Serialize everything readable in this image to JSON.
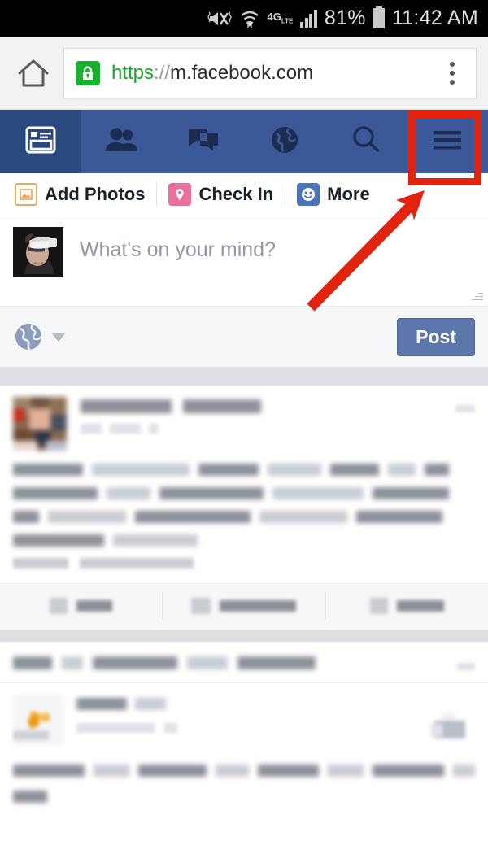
{
  "status_bar": {
    "icons": [
      "mute-vibrate-icon",
      "wifi-icon",
      "signal-bars-icon"
    ],
    "network_label": "4G",
    "network_sub": "LTE",
    "battery_percent": "81%",
    "time": "11:42 AM"
  },
  "browser": {
    "home_icon": "home-icon",
    "lock_icon": "lock-icon",
    "url_scheme": "https",
    "url_separator": "://",
    "url_host": "m.facebook.com",
    "menu_icon": "kebab-menu-icon"
  },
  "fb_nav": {
    "tabs": [
      {
        "name": "news-feed",
        "icon": "news-feed-icon",
        "active": true
      },
      {
        "name": "friend-requests",
        "icon": "friends-icon",
        "active": false
      },
      {
        "name": "messages",
        "icon": "messages-icon",
        "active": false
      },
      {
        "name": "notifications",
        "icon": "globe-notifications-icon",
        "active": false
      },
      {
        "name": "search",
        "icon": "search-icon",
        "active": false
      },
      {
        "name": "main-menu",
        "icon": "hamburger-menu-icon",
        "active": false
      }
    ],
    "nav_color": "#3B5998",
    "active_color": "#29487D"
  },
  "composer": {
    "actions": [
      {
        "label": "Add Photos",
        "icon": "photo-icon",
        "color": "#E8A760"
      },
      {
        "label": "Check In",
        "icon": "location-pin-icon",
        "color": "#EB6F9E"
      },
      {
        "label": "More",
        "icon": "smiley-icon",
        "color": "#4B75BA"
      }
    ],
    "avatar": "user-avatar-vr-headset",
    "placeholder": "What's on your mind?",
    "status_value": "",
    "privacy_icon": "globe-privacy-icon",
    "privacy_caret": "chevron-down-icon",
    "post_button": "Post"
  },
  "feed": {
    "posts": [
      {
        "type": "status",
        "avatar": "post-author-avatar",
        "author_redacted": true,
        "timestamp_redacted": true,
        "body_lines": 4,
        "counts_redacted": true,
        "actions": [
          {
            "label_redacted": true,
            "icon": "thumbs-up-icon",
            "name": "like-button"
          },
          {
            "label_redacted": true,
            "icon": "comment-icon",
            "name": "comment-button"
          },
          {
            "label_redacted": true,
            "icon": "share-icon",
            "name": "share-button"
          }
        ]
      },
      {
        "type": "story-headline",
        "headline_redacted": true
      },
      {
        "type": "sponsored",
        "avatar": "sponsored-page-logo",
        "page_name_redacted": true,
        "sponsored_label_redacted": true,
        "thumbnail": "sponsored-thumbnail",
        "body_lines": 2
      }
    ]
  },
  "annotations": {
    "highlight_box": {
      "name": "hamburger-menu-highlight",
      "color": "#E4230F",
      "target": "main-menu-button"
    },
    "arrow": {
      "name": "pointer-arrow",
      "color": "#E4230F",
      "points_to": "hamburger-menu-highlight"
    }
  }
}
